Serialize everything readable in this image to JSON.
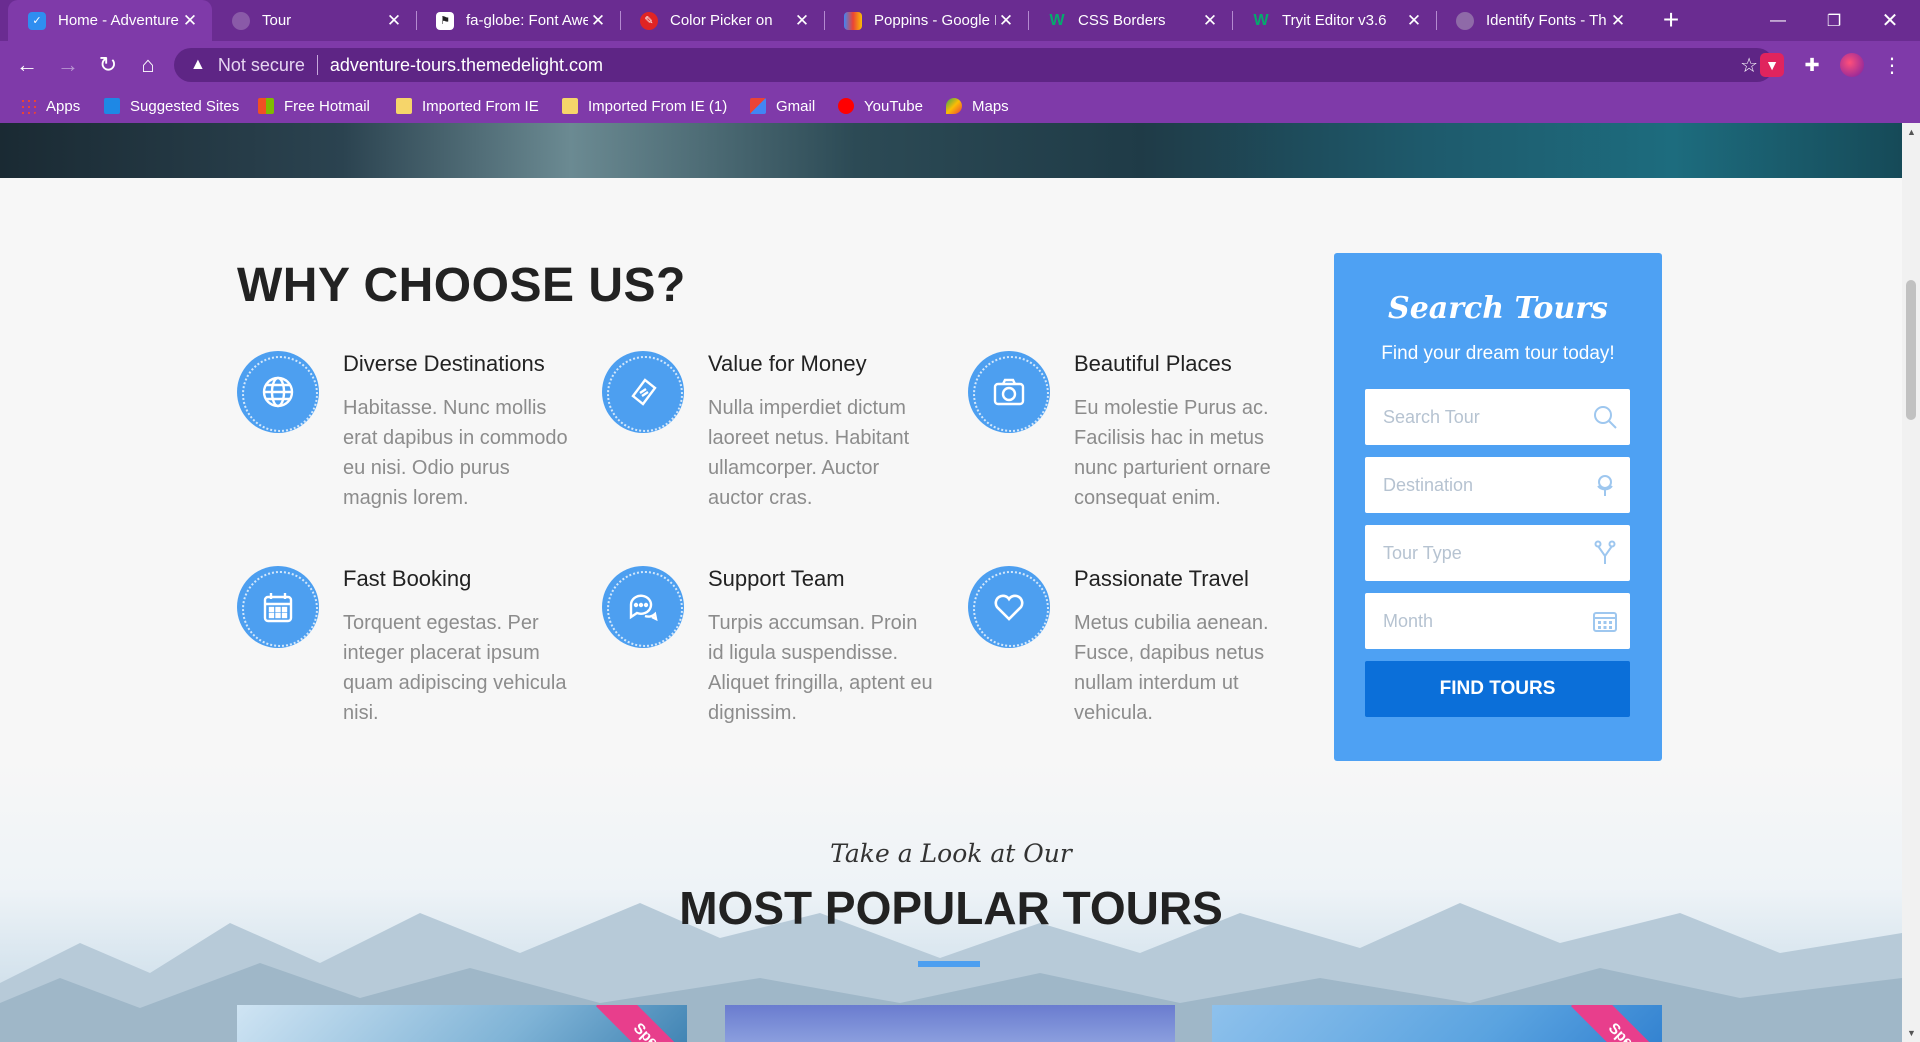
{
  "browser": {
    "tabs": [
      {
        "label": "Home - Adventure",
        "active": true
      },
      {
        "label": "Tour",
        "active": false
      },
      {
        "label": "fa-globe: Font Awe",
        "active": false
      },
      {
        "label": "Color Picker on",
        "active": false
      },
      {
        "label": "Poppins - Google F",
        "active": false
      },
      {
        "label": "CSS Borders",
        "active": false
      },
      {
        "label": "Tryit Editor v3.6",
        "active": false
      },
      {
        "label": "Identify Fonts - Th",
        "active": false
      }
    ],
    "address": {
      "security": "Not secure",
      "url": "adventure-tours.themedelight.com"
    },
    "bookmarks": [
      {
        "label": "Apps"
      },
      {
        "label": "Suggested Sites"
      },
      {
        "label": "Free Hotmail"
      },
      {
        "label": "Imported From IE"
      },
      {
        "label": "Imported From IE (1)"
      },
      {
        "label": "Gmail"
      },
      {
        "label": "YouTube"
      },
      {
        "label": "Maps"
      }
    ],
    "colors": {
      "frame": "#6a2c91",
      "toolbar": "#7f3aa9"
    }
  },
  "why": {
    "title": "WHY CHOOSE US?",
    "features": [
      {
        "title": "Diverse Destinations",
        "text": "Habitasse. Nunc mollis erat dapibus in commodo eu nisi. Odio purus magnis lorem.",
        "icon": "globe-icon"
      },
      {
        "title": "Value for Money",
        "text": "Nulla imperdiet dictum laoreet netus. Habitant ullamcorper. Auctor auctor cras.",
        "icon": "ticket-icon"
      },
      {
        "title": "Beautiful Places",
        "text": "Eu molestie Purus ac. Facilisis hac in metus nunc parturient ornare consequat enim.",
        "icon": "camera-icon"
      },
      {
        "title": "Fast Booking",
        "text": "Torquent egestas. Per integer placerat ipsum quam adipiscing vehicula nisi.",
        "icon": "calendar-icon"
      },
      {
        "title": "Support Team",
        "text": "Turpis accumsan. Proin id ligula suspendisse. Aliquet fringilla, aptent eu dignissim.",
        "icon": "chat-icon"
      },
      {
        "title": "Passionate Travel",
        "text": "Metus cubilia aenean. Fusce, dapibus netus nullam interdum ut vehicula.",
        "icon": "heart-icon"
      }
    ]
  },
  "search": {
    "title": "Search Tours",
    "subtitle": "Find your dream tour today!",
    "fields": [
      {
        "placeholder": "Search Tour",
        "icon": "search-icon"
      },
      {
        "placeholder": "Destination",
        "icon": "location-icon"
      },
      {
        "placeholder": "Tour Type",
        "icon": "fork-icon"
      },
      {
        "placeholder": "Month",
        "icon": "calendar-icon"
      }
    ],
    "button": "FIND TOURS",
    "accent": "#4ea1f3",
    "button_color": "#0b6fd9"
  },
  "popular": {
    "subtitle": "Take a Look at Our",
    "title": "MOST POPULAR TOURS",
    "ribbon": "Spec"
  }
}
